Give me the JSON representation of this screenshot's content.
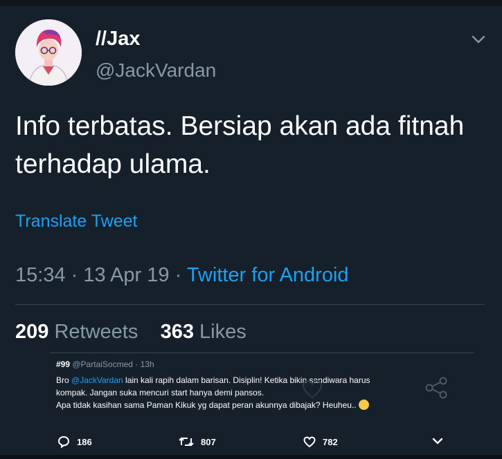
{
  "tweet": {
    "display_name": "//Jax",
    "handle": "@JackVardan",
    "text": "Info terbatas. Bersiap akan ada fitnah terhadap ulama.",
    "translate_label": "Translate Tweet",
    "time": "15:34",
    "date": "13 Apr 19",
    "source": "Twitter for Android",
    "separator": "·"
  },
  "stats": {
    "retweets_count": "209",
    "retweets_label": "Retweets",
    "likes_count": "363",
    "likes_label": "Likes"
  },
  "reply": {
    "name": "#99",
    "handle": "@PartaiSocmed",
    "age": "· 13h",
    "line1_prefix": "Bro ",
    "line1_mention": "@JackVardan",
    "line1_suffix": " lain kali rapih dalam barisan. Disiplin! Ketika bikin sandiwara harus",
    "line2": "kompak. Jangan suka mencuri start hanya demi pansos.",
    "line3": "Apa tidak kasihan sama Paman Kikuk yg dapat peran akunnya dibajak? Heuheu..",
    "emoji": "face-with-tears-of-joy"
  },
  "actions": {
    "replies": "186",
    "retweets": "807",
    "likes": "782"
  },
  "colors": {
    "background": "#15202b",
    "accent": "#1da1f2",
    "muted": "#8899a6"
  }
}
